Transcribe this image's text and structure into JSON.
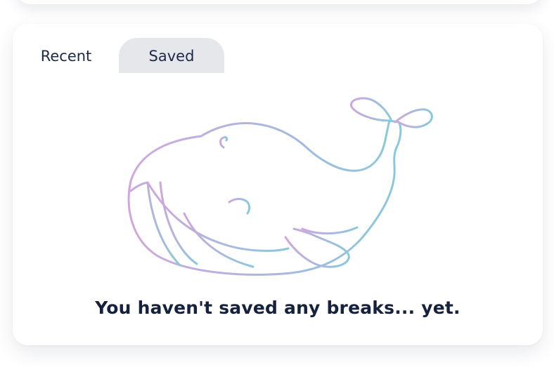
{
  "tabs": [
    {
      "label": "Recent",
      "active": false
    },
    {
      "label": "Saved",
      "active": true
    }
  ],
  "empty_state": {
    "message": "You haven't saved any breaks... yet.",
    "illustration": "whale-outline-icon",
    "gradient_start": "#d0a6de",
    "gradient_end": "#88c9dc"
  },
  "colors": {
    "text": "#1c2a48",
    "active_tab_bg": "#e6e7eb",
    "card_bg": "#ffffff"
  }
}
